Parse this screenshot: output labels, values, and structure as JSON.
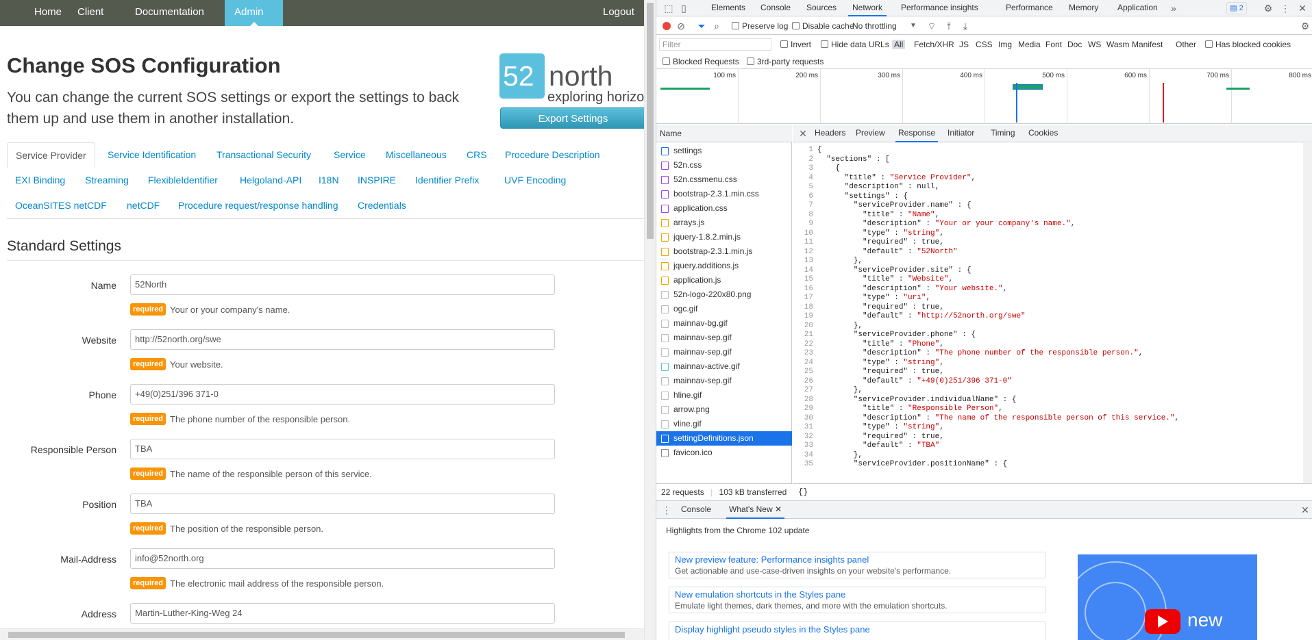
{
  "nav": {
    "items": [
      "Home",
      "Client",
      "Documentation",
      "Admin"
    ],
    "logout": "Logout"
  },
  "header": {
    "title": "Change SOS Configuration",
    "lead": "You can change the current SOS settings or export the settings to back them up and use them in another installation.",
    "logo_num": "52",
    "logo_word": "north",
    "logo_tagline": "exploring horizon",
    "export_label": "Export Settings"
  },
  "tabs": [
    "Service Provider",
    "Service Identification",
    "Transactional Security",
    "Service",
    "Miscellaneous",
    "CRS",
    "Procedure Description",
    "EXI Binding",
    "Streaming",
    "FlexibleIdentifier",
    "Helgoland-API",
    "I18N",
    "INSPIRE",
    "Identifier Prefix",
    "UVF Encoding",
    "OceanSITES netCDF",
    "netCDF",
    "Procedure request/response handling",
    "Credentials"
  ],
  "section_title": "Standard Settings",
  "required_badge": "required",
  "fields": [
    {
      "label": "Name",
      "value": "52North",
      "help": "Your or your company's name."
    },
    {
      "label": "Website",
      "value": "http://52north.org/swe",
      "help": "Your website."
    },
    {
      "label": "Phone",
      "value": "+49(0)251/396 371-0",
      "help": "The phone number of the responsible person."
    },
    {
      "label": "Responsible Person",
      "value": "TBA",
      "help": "The name of the responsible person of this service."
    },
    {
      "label": "Position",
      "value": "TBA",
      "help": "The position of the responsible person."
    },
    {
      "label": "Mail-Address",
      "value": "info@52north.org",
      "help": "The electronic mail address of the responsible person."
    },
    {
      "label": "Address",
      "value": "Martin-Luther-King-Weg 24",
      "help": ""
    }
  ],
  "devtools": {
    "tabs": [
      "Elements",
      "Console",
      "Sources",
      "Network",
      "Performance insights",
      "Performance",
      "Memory",
      "Application"
    ],
    "active_tab": "Network",
    "issues_count": "2",
    "toolbar": {
      "preserve_log": "Preserve log",
      "disable_cache": "Disable cache",
      "throttling": "No throttling"
    },
    "filter": {
      "placeholder": "Filter",
      "invert": "Invert",
      "hide_data_urls": "Hide data URLs",
      "types": [
        "All",
        "Fetch/XHR",
        "JS",
        "CSS",
        "Img",
        "Media",
        "Font",
        "Doc",
        "WS",
        "Wasm",
        "Manifest",
        "Other"
      ],
      "has_blocked_cookies": "Has blocked cookies",
      "blocked_requests": "Blocked Requests",
      "third_party": "3rd-party requests"
    },
    "timeline_labels": [
      "100 ms",
      "200 ms",
      "300 ms",
      "400 ms",
      "500 ms",
      "600 ms",
      "700 ms",
      "800 ms"
    ],
    "request_list": {
      "header": "Name",
      "items": [
        "settings",
        "52n.css",
        "52n.cssmenu.css",
        "bootstrap-2.3.1.min.css",
        "application.css",
        "arrays.js",
        "jquery-1.8.2.min.js",
        "bootstrap-2.3.1.min.js",
        "jquery.additions.js",
        "application.js",
        "52n-logo-220x80.png",
        "ogc.gif",
        "mainnav-bg.gif",
        "mainnav-sep.gif",
        "mainnav-sep.gif",
        "mainnav-active.gif",
        "mainnav-sep.gif",
        "hline.gif",
        "arrow.png",
        "vline.gif",
        "settingDefinitions.json",
        "favicon.ico"
      ],
      "selected": "settingDefinitions.json",
      "summary_requests": "22 requests",
      "summary_transferred": "103 kB transferred"
    },
    "detail_tabs": [
      "Headers",
      "Preview",
      "Response",
      "Initiator",
      "Timing",
      "Cookies"
    ],
    "detail_active": "Response",
    "code_lines": [
      "{",
      "  \"sections\" : [",
      "    {",
      "      \"title\" : \"Service Provider\",",
      "      \"description\" : null,",
      "      \"settings\" : {",
      "        \"serviceProvider.name\" : {",
      "          \"title\" : \"Name\",",
      "          \"description\" : \"Your or your company's name.\",",
      "          \"type\" : \"string\",",
      "          \"required\" : true,",
      "          \"default\" : \"52North\"",
      "        },",
      "        \"serviceProvider.site\" : {",
      "          \"title\" : \"Website\",",
      "          \"description\" : \"Your website.\",",
      "          \"type\" : \"uri\",",
      "          \"required\" : true,",
      "          \"default\" : \"http://52north.org/swe\"",
      "        },",
      "        \"serviceProvider.phone\" : {",
      "          \"title\" : \"Phone\",",
      "          \"description\" : \"The phone number of the responsible person.\",",
      "          \"type\" : \"string\",",
      "          \"required\" : true,",
      "          \"default\" : \"+49(0)251/396 371-0\"",
      "        },",
      "        \"serviceProvider.individualName\" : {",
      "          \"title\" : \"Responsible Person\",",
      "          \"description\" : \"The name of the responsible person of this service.\",",
      "          \"type\" : \"string\",",
      "          \"required\" : true,",
      "          \"default\" : \"TBA\"",
      "        },",
      "        \"serviceProvider.positionName\" : {"
    ],
    "pretty_print": "{}",
    "drawer": {
      "tabs": [
        "Console",
        "What's New"
      ],
      "active": "What's New",
      "subtitle": "Highlights from the Chrome 102 update",
      "cards": [
        {
          "title": "New preview feature: Performance insights panel",
          "desc": "Get actionable and use-case-driven insights on your website's performance."
        },
        {
          "title": "New emulation shortcuts in the Styles pane",
          "desc": "Emulate light themes, dark themes, and more with the emulation shortcuts."
        },
        {
          "title": "Display highlight pseudo styles in the Styles pane",
          "desc": ""
        }
      ],
      "video_text": "new"
    }
  },
  "colors": {
    "nav_bg": "#555a4e",
    "accent": "#5bc0de",
    "link": "#0088cc",
    "required": "#f89406",
    "devtools_blue": "#1a73e8",
    "json_string": "#c80000"
  }
}
